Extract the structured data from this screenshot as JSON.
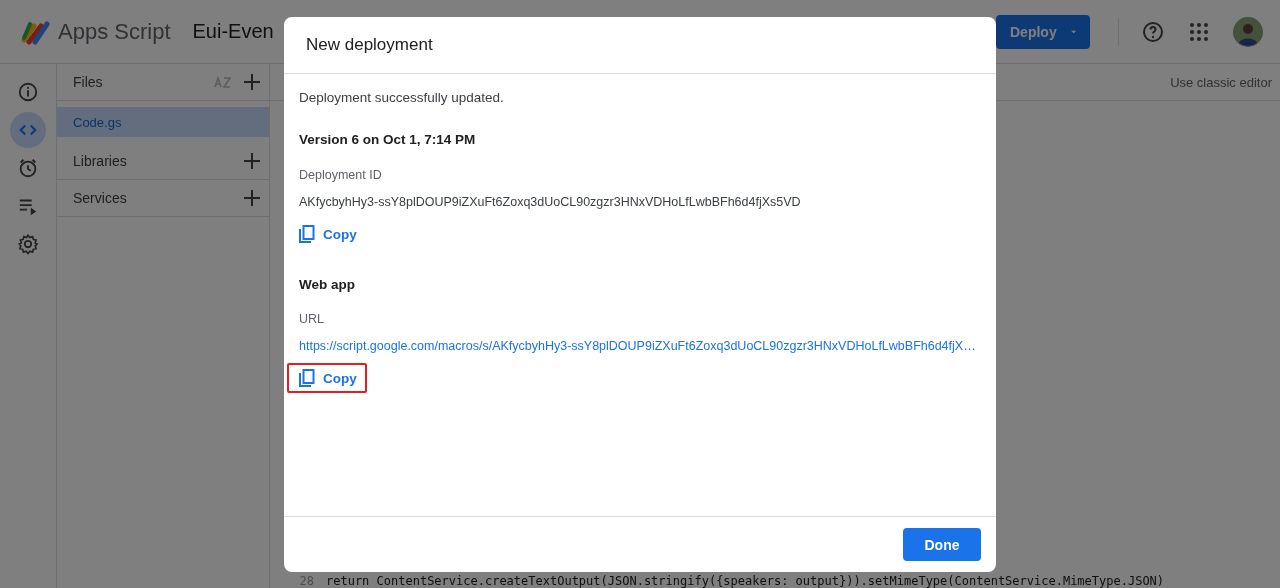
{
  "app": {
    "name": "Apps Script",
    "project_title": "Eui-Even"
  },
  "header": {
    "deploy_button": "Deploy"
  },
  "rail": [
    {
      "kind": "info",
      "selected": false
    },
    {
      "kind": "code",
      "selected": true
    },
    {
      "kind": "clock",
      "selected": false
    },
    {
      "kind": "executions",
      "selected": false
    },
    {
      "kind": "settings",
      "selected": false
    }
  ],
  "sidebar": {
    "sections": [
      {
        "title": "Files",
        "kind": "files",
        "items": [
          {
            "label": "Code.gs",
            "selected": true
          }
        ]
      },
      {
        "title": "Libraries",
        "kind": "add"
      },
      {
        "title": "Services",
        "kind": "add"
      }
    ]
  },
  "editor": {
    "classic_link": "Use classic editor",
    "lines": [
      {
        "number": "28",
        "code": "return ContentService.createTextOutput(JSON.stringify({speakers: output})).setMimeType(ContentService.MimeType.JSON)"
      }
    ]
  },
  "dialog": {
    "title": "New deployment",
    "message": "Deployment successfully updated.",
    "version": "Version 6 on Oct 1, 7:14 PM",
    "sections": [
      {
        "label": "Deployment ID",
        "value": "AKfycbyhHy3-ssY8plDOUP9iZXuFt6Zoxq3dUoCL90zgzr3HNxVDHoLfLwbBFh6d4fjXs5VD",
        "kind": "text",
        "copy": "Copy",
        "highlighted": false
      },
      {
        "heading": "Web app",
        "label": "URL",
        "value": "https://script.google.com/macros/s/AKfycbyhHy3-ssY8plDOUP9iZXuFt6Zoxq3dUoCL90zgzr3HNxVDHoLfLwbBFh6d4fjX…",
        "kind": "link",
        "copy": "Copy",
        "highlighted": true
      }
    ],
    "done_button": "Done"
  }
}
